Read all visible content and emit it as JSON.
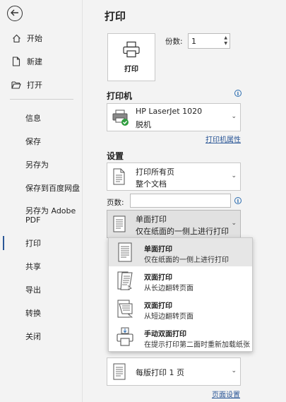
{
  "sidebar": {
    "nav_top": [
      {
        "label": "开始",
        "icon": "home-icon"
      },
      {
        "label": "新建",
        "icon": "new-document-icon"
      },
      {
        "label": "打开",
        "icon": "open-folder-icon"
      }
    ],
    "nav": [
      {
        "label": "信息"
      },
      {
        "label": "保存"
      },
      {
        "label": "另存为"
      },
      {
        "label": "保存到百度网盘"
      },
      {
        "label": "另存为 Adobe\nPDF"
      },
      {
        "label": "打印"
      },
      {
        "label": "共享"
      },
      {
        "label": "导出"
      },
      {
        "label": "转换"
      },
      {
        "label": "关闭"
      }
    ],
    "active": "打印",
    "accent_color": "#2b5797"
  },
  "main": {
    "title": "打印",
    "print_button_label": "打印",
    "copies_label": "份数:",
    "copies_value": "1",
    "printer_section": "打印机",
    "printer_name": "HP LaserJet 1020",
    "printer_status": "脱机",
    "printer_properties_link": "打印机属性",
    "settings_section": "设置",
    "print_range_title": "打印所有页",
    "print_range_desc": "整个文档",
    "pages_label": "页数:",
    "pages_value": "",
    "sided_title": "单面打印",
    "sided_desc": "仅在纸面的一侧上进行打印",
    "pages_per_sheet": "每版打印 1 页",
    "page_setup_link": "页面设置"
  },
  "sided_menu": [
    {
      "title": "单面打印",
      "desc": "仅在纸面的一侧上进行打印",
      "icon": "single-sided-icon",
      "selected": true
    },
    {
      "title": "双面打印",
      "desc": "从长边翻转页面",
      "icon": "duplex-long-edge-icon",
      "selected": false
    },
    {
      "title": "双面打印",
      "desc": "从短边翻转页面",
      "icon": "duplex-short-edge-icon",
      "selected": false
    },
    {
      "title": "手动双面打印",
      "desc": "在提示打印第二面时重新加载纸张",
      "icon": "manual-duplex-icon",
      "selected": false
    }
  ]
}
